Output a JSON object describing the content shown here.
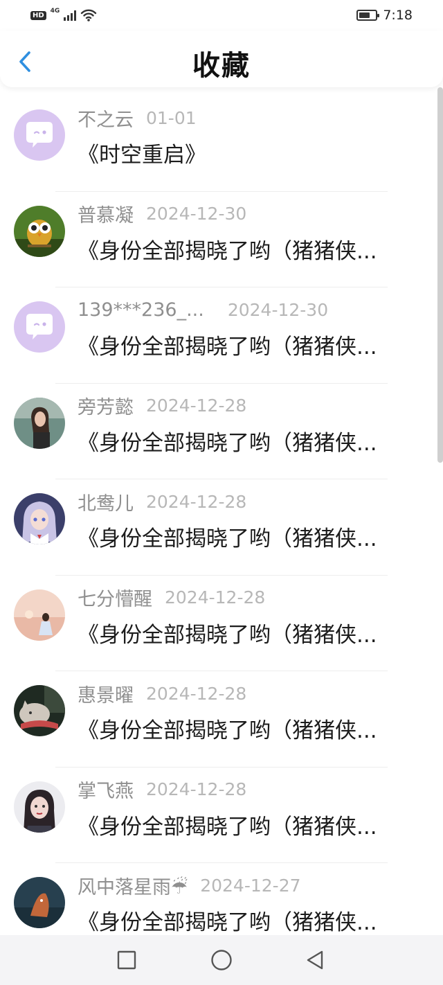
{
  "status_bar": {
    "hd": "HD",
    "network": "4G",
    "time": "7:18",
    "battery_level": 0.7
  },
  "header": {
    "back_icon": "chevron-left-icon",
    "title": "收藏"
  },
  "colors": {
    "accent": "#2f8fe0",
    "default_avatar": "#d9c6f1",
    "name_text": "#8f8f8f",
    "date_text": "#b7b7b7",
    "nav_bar": "#f4f4f6"
  },
  "items": [
    {
      "name": "不之云",
      "date": "01-01",
      "text": "《时空重启》",
      "avatar": "default-chat-icon"
    },
    {
      "name": "普慕凝",
      "date": "2024-12-30",
      "text": "《身份全部揭晓了哟（猪猪侠...",
      "avatar": "owl-avatar"
    },
    {
      "name": "139***236_...",
      "date": "2024-12-30",
      "text": "《身份全部揭晓了哟（猪猪侠...",
      "avatar": "default-chat-icon"
    },
    {
      "name": "旁芳懿",
      "date": "2024-12-28",
      "text": "《身份全部揭晓了哟（猪猪侠...",
      "avatar": "girl-photo-avatar"
    },
    {
      "name": "北鸯儿",
      "date": "2024-12-28",
      "text": "《身份全部揭晓了哟（猪猪侠...",
      "avatar": "anime-girl-avatar"
    },
    {
      "name": "七分懵醒",
      "date": "2024-12-28",
      "text": "《身份全部揭晓了哟（猪猪侠...",
      "avatar": "sunset-avatar"
    },
    {
      "name": "惠景曜",
      "date": "2024-12-28",
      "text": "《身份全部揭晓了哟（猪猪侠...",
      "avatar": "cat-avatar"
    },
    {
      "name": "掌飞燕",
      "date": "2024-12-28",
      "text": "《身份全部揭晓了哟（猪猪侠...",
      "avatar": "woman-portrait-avatar"
    },
    {
      "name": "风中落星雨☔",
      "date": "2024-12-27",
      "text": "《身份全部揭晓了哟（猪猪侠...",
      "avatar": "fish-avatar"
    }
  ],
  "nav": {
    "recents_icon": "square-icon",
    "home_icon": "circle-icon",
    "back_icon": "triangle-back-icon"
  }
}
